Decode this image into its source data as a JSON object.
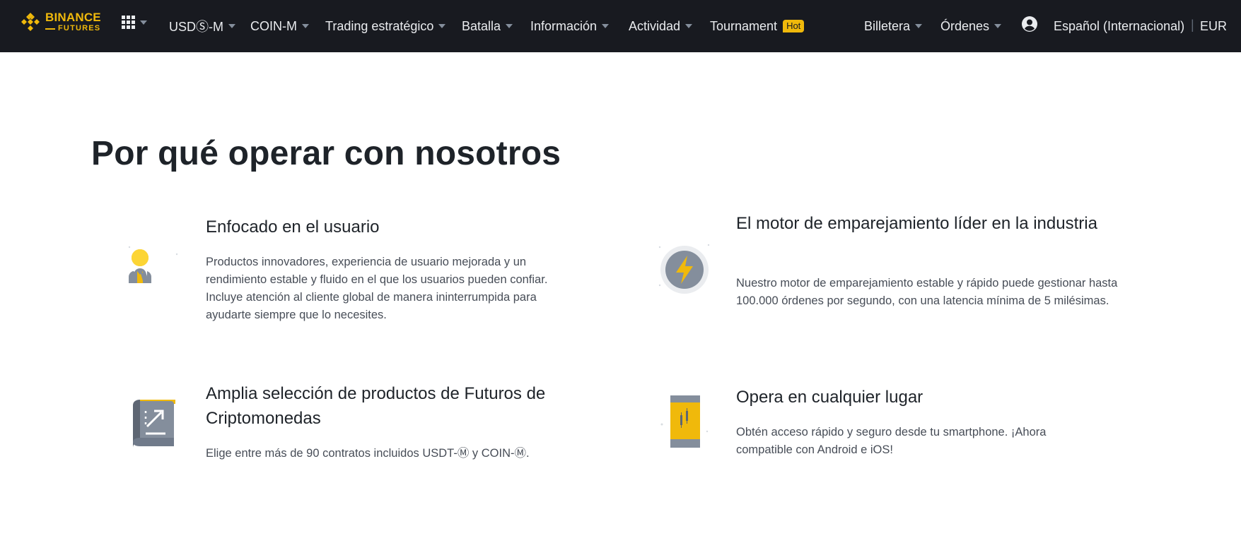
{
  "nav": {
    "logo_main": "BINANCE",
    "logo_sub": "FUTURES",
    "items": [
      {
        "label": "USDⓈ-M"
      },
      {
        "label": "COIN-M"
      },
      {
        "label": "Trading estratégico"
      },
      {
        "label": "Batalla"
      },
      {
        "label": "Información"
      },
      {
        "label": "Actividad"
      },
      {
        "label": "Tournament",
        "badge": "Hot"
      }
    ],
    "wallet": "Billetera",
    "orders": "Órdenes",
    "language": "Español (Internacional)",
    "separator": "|",
    "currency": "EUR"
  },
  "main": {
    "title": "Por qué operar con nosotros",
    "features": [
      {
        "icon": "user-icon",
        "title": "Enfocado en el usuario",
        "desc": "Productos innovadores, experiencia de usuario mejorada y un rendimiento estable y fluido en el que los usuarios pueden confiar. Incluye atención al cliente global de manera ininterrumpida para ayudarte siempre que lo necesites."
      },
      {
        "icon": "lightning-icon",
        "title": "El motor de emparejamiento líder en la industria",
        "desc": "Nuestro motor de emparejamiento estable y rápido puede gestionar hasta 100.000 órdenes por segundo, con una latencia mínima de 5 milésimas."
      },
      {
        "icon": "chart-document-icon",
        "title": "Amplia selección de productos de Futuros de Criptomonedas",
        "desc": "Elige entre más de 90 contratos incluidos USDT-Ⓜ y COIN-Ⓜ."
      },
      {
        "icon": "smartphone-icon",
        "title": "Opera en cualquier lugar",
        "desc": "Obtén acceso rápido y seguro desde tu smartphone. ¡Ahora compatible con Android e iOS!"
      }
    ]
  },
  "colors": {
    "brand": "#f0b90b",
    "nav_bg": "#181a20",
    "text_dark": "#1e2329",
    "text_body": "#474d57"
  }
}
